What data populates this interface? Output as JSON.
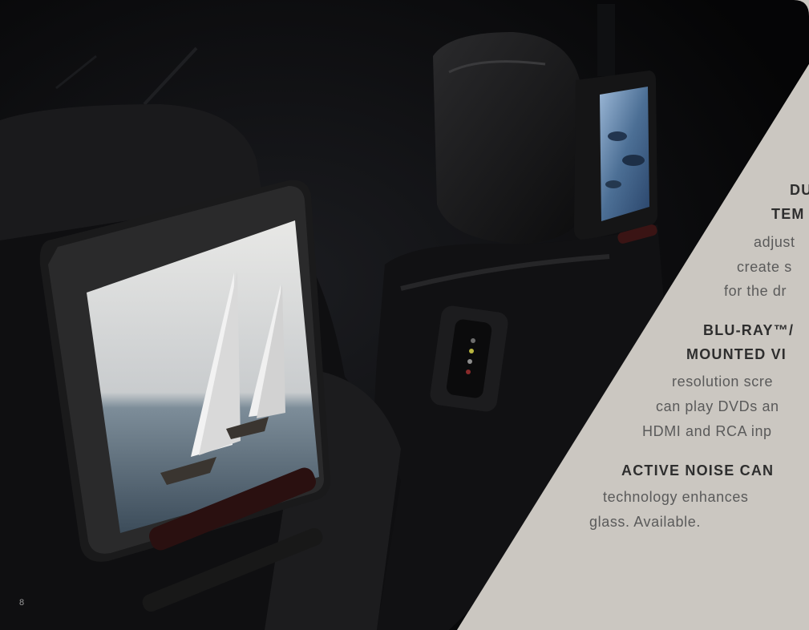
{
  "page_number": "8",
  "feature_text": {
    "dual_heading_1": "DU",
    "dual_heading_2": "TEM",
    "dual_body_1": "adjust",
    "dual_body_2": "create s",
    "dual_body_3": "for the dr",
    "bluray_heading_1": "BLU-RAY™/",
    "bluray_heading_2": "MOUNTED VI",
    "bluray_body_1": "resolution scre",
    "bluray_body_2": "can play DVDs an",
    "bluray_body_3": "HDMI and RCA inp",
    "noise_heading": "ACTIVE NOISE CAN",
    "noise_body_1": "technology enhances",
    "noise_body_2": "glass. Available."
  },
  "colors": {
    "panel_background": "#cbc7c1",
    "heading_text": "#2e2e2e",
    "body_text": "#5a5a5a",
    "photo_dark": "#0a0a0b",
    "accent_red": "#7a1c1c"
  }
}
